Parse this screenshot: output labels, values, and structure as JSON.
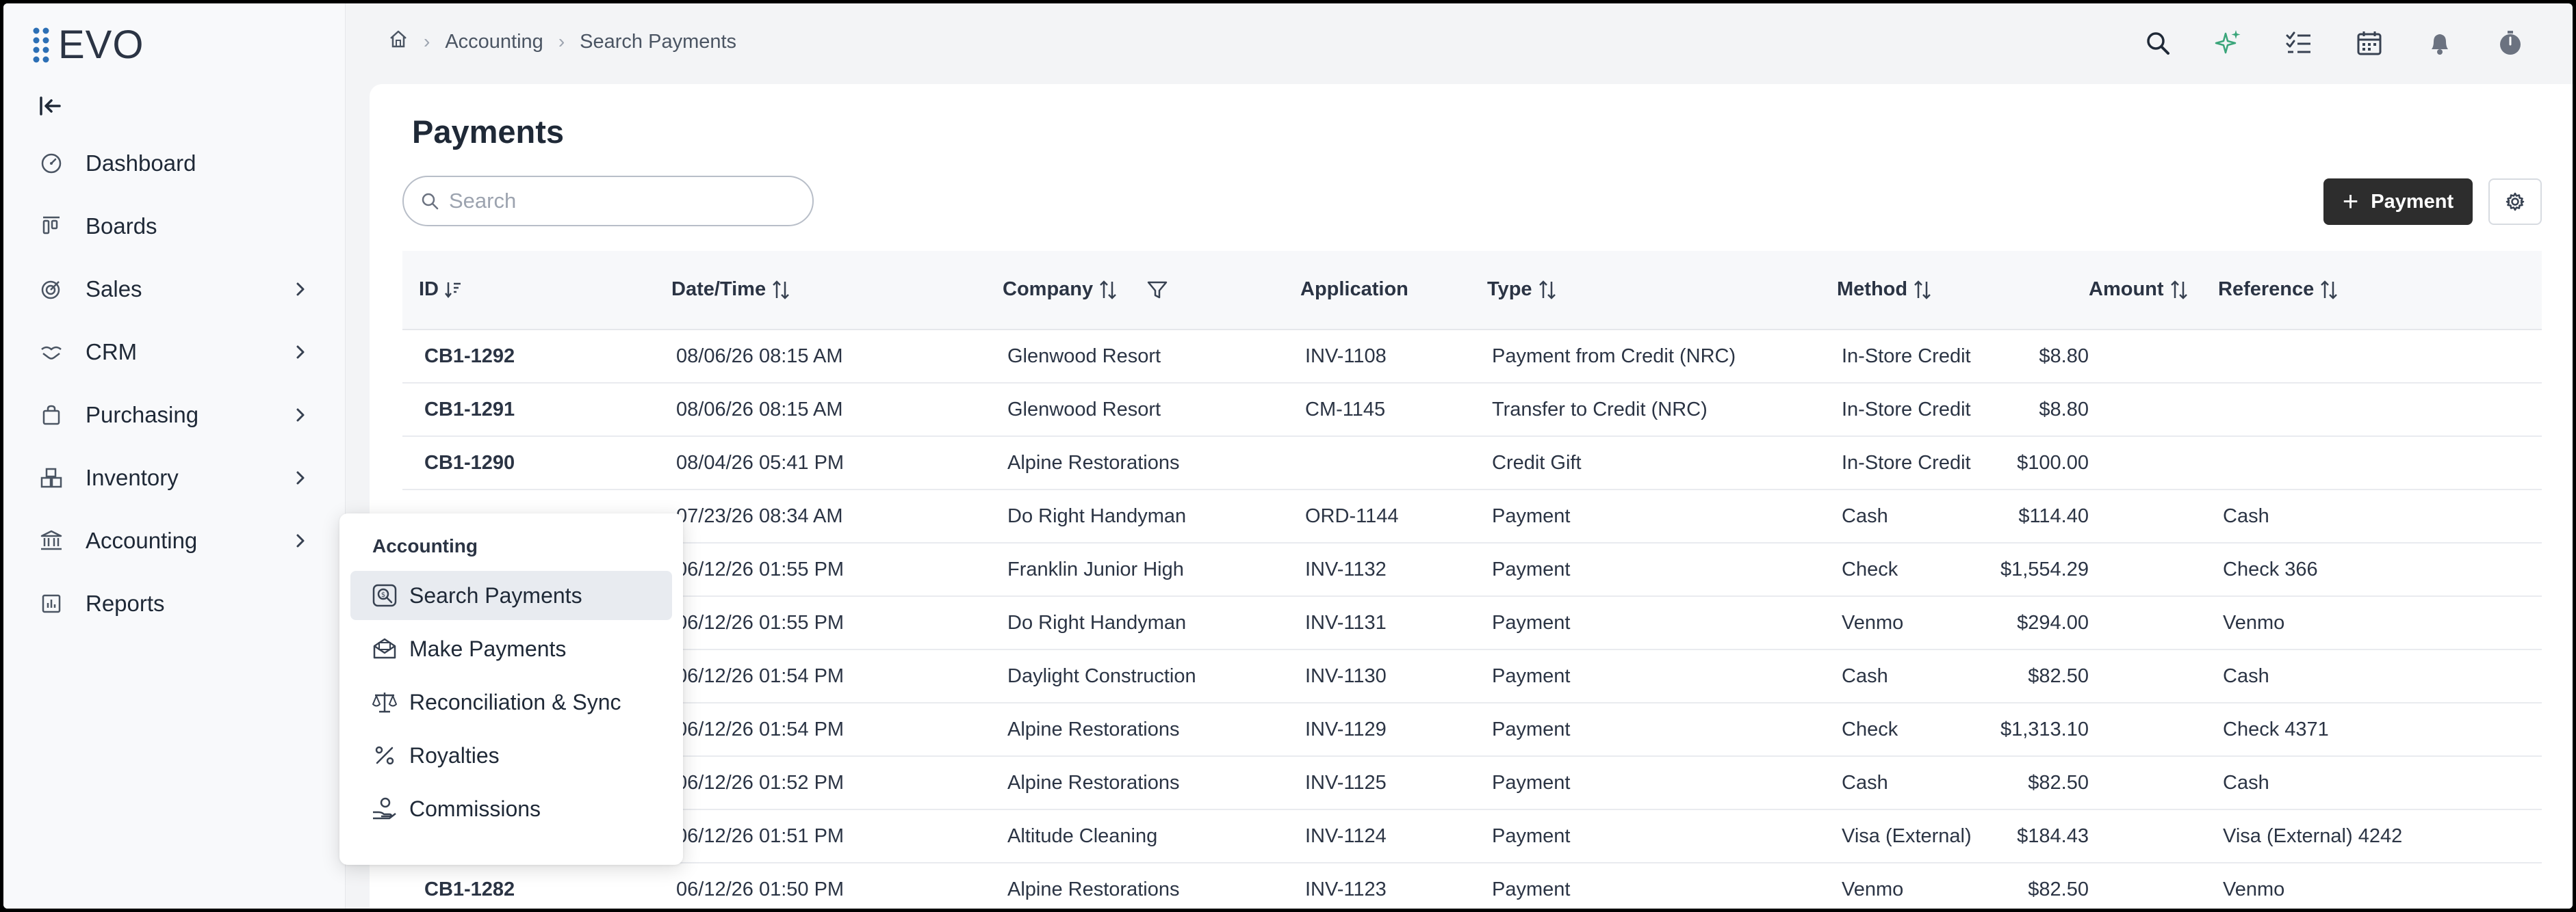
{
  "app": {
    "logo_text": "EVO",
    "brand_color": "#2c6fb5"
  },
  "sidebar": {
    "items": [
      {
        "label": "Dashboard",
        "icon": "dashboard-icon",
        "has_submenu": false
      },
      {
        "label": "Boards",
        "icon": "boards-icon",
        "has_submenu": false
      },
      {
        "label": "Sales",
        "icon": "sales-icon",
        "has_submenu": true
      },
      {
        "label": "CRM",
        "icon": "crm-icon",
        "has_submenu": true
      },
      {
        "label": "Purchasing",
        "icon": "purchasing-icon",
        "has_submenu": true
      },
      {
        "label": "Inventory",
        "icon": "inventory-icon",
        "has_submenu": true
      },
      {
        "label": "Accounting",
        "icon": "accounting-icon",
        "has_submenu": true
      },
      {
        "label": "Reports",
        "icon": "reports-icon",
        "has_submenu": false
      }
    ]
  },
  "breadcrumb": {
    "items": [
      "Accounting",
      "Search Payments"
    ]
  },
  "header": {
    "icons": [
      "search-icon",
      "ai-sparkle-icon",
      "tasks-icon",
      "calendar-icon",
      "bell-icon",
      "timer-icon"
    ]
  },
  "main": {
    "title": "Payments",
    "search": {
      "placeholder": "Search",
      "value": ""
    },
    "add_button_label": "Payment",
    "table": {
      "columns": [
        "ID",
        "Date/Time",
        "Company",
        "Application",
        "Type",
        "Method",
        "Amount",
        "Reference"
      ],
      "rows": [
        [
          "CB1-1292",
          "08/06/26 08:15 AM",
          "Glenwood Resort",
          "INV-1108",
          "Payment from Credit (NRC)",
          "In-Store Credit",
          "$8.80",
          ""
        ],
        [
          "CB1-1291",
          "08/06/26 08:15 AM",
          "Glenwood Resort",
          "CM-1145",
          "Transfer to Credit (NRC)",
          "In-Store Credit",
          "$8.80",
          ""
        ],
        [
          "CB1-1290",
          "08/04/26 05:41 PM",
          "Alpine Restorations",
          "",
          "Credit Gift",
          "In-Store Credit",
          "$100.00",
          ""
        ],
        [
          "",
          "07/23/26 08:34 AM",
          "Do Right Handyman",
          "ORD-1144",
          "Payment",
          "Cash",
          "$114.40",
          "Cash"
        ],
        [
          "",
          "06/12/26 01:55 PM",
          "Franklin Junior High",
          "INV-1132",
          "Payment",
          "Check",
          "$1,554.29",
          "Check 366"
        ],
        [
          "",
          "06/12/26 01:55 PM",
          "Do Right Handyman",
          "INV-1131",
          "Payment",
          "Venmo",
          "$294.00",
          "Venmo"
        ],
        [
          "",
          "06/12/26 01:54 PM",
          "Daylight Construction",
          "INV-1130",
          "Payment",
          "Cash",
          "$82.50",
          "Cash"
        ],
        [
          "",
          "06/12/26 01:54 PM",
          "Alpine Restorations",
          "INV-1129",
          "Payment",
          "Check",
          "$1,313.10",
          "Check 4371"
        ],
        [
          "",
          "06/12/26 01:52 PM",
          "Alpine Restorations",
          "INV-1125",
          "Payment",
          "Cash",
          "$82.50",
          "Cash"
        ],
        [
          "",
          "06/12/26 01:51 PM",
          "Altitude Cleaning",
          "INV-1124",
          "Payment",
          "Visa (External)",
          "$184.43",
          "Visa (External) 4242"
        ],
        [
          "CB1-1282",
          "06/12/26 01:50 PM",
          "Alpine Restorations",
          "INV-1123",
          "Payment",
          "Venmo",
          "$82.50",
          "Venmo"
        ]
      ]
    }
  },
  "flyout": {
    "title": "Accounting",
    "items": [
      {
        "label": "Search Payments",
        "icon": "search-payments-icon",
        "active": true
      },
      {
        "label": "Make Payments",
        "icon": "make-payments-icon",
        "active": false
      },
      {
        "label": "Reconciliation & Sync",
        "icon": "scale-icon",
        "active": false
      },
      {
        "label": "Royalties",
        "icon": "percent-icon",
        "active": false
      },
      {
        "label": "Commissions",
        "icon": "hand-coin-icon",
        "active": false
      }
    ]
  }
}
